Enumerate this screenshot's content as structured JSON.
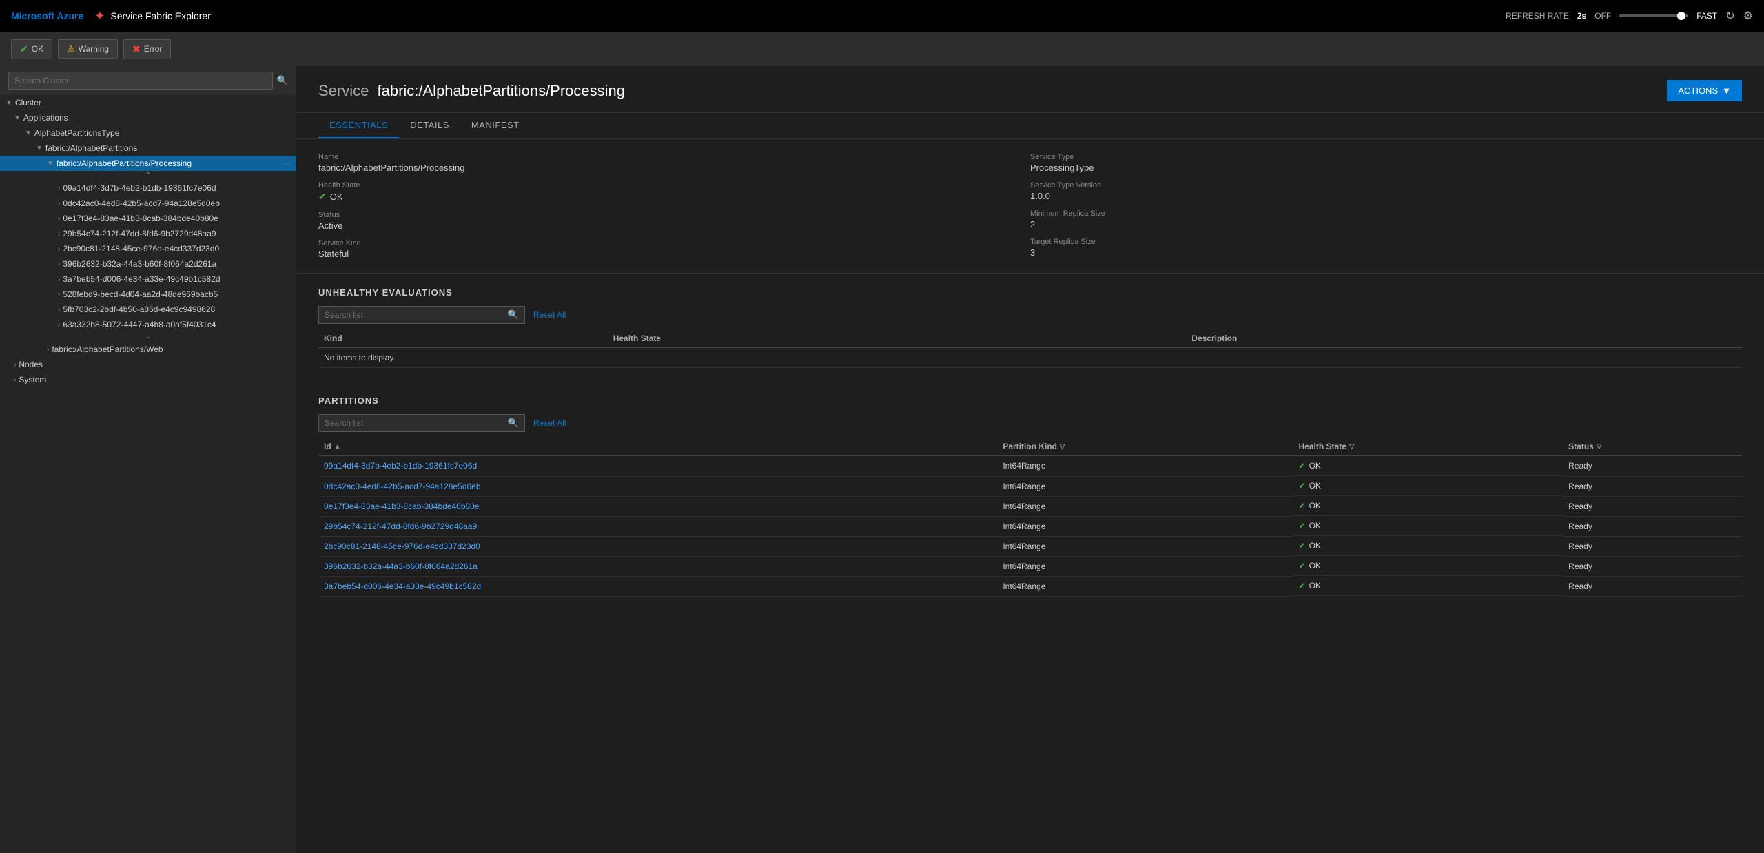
{
  "topnav": {
    "azure_label": "Microsoft Azure",
    "app_title": "Service Fabric Explorer",
    "refresh_rate_label": "REFRESH RATE",
    "refresh_value": "2s",
    "off_label": "OFF",
    "fast_label": "FAST"
  },
  "statusbar": {
    "ok_label": "OK",
    "warning_label": "Warning",
    "error_label": "Error"
  },
  "sidebar": {
    "search_placeholder": "Search Cluster",
    "cluster_label": "Cluster",
    "applications_label": "Applications",
    "alphabet_type_label": "AlphabetPartitionsType",
    "alphabet_app_label": "fabric:/AlphabetPartitions",
    "processing_label": "fabric:/AlphabetPartitions/Processing",
    "partitions": [
      "09a14df4-3d7b-4eb2-b1db-19361fc7e06d",
      "0dc42ac0-4ed8-42b5-acd7-94a128e5d0eb",
      "0e17f3e4-83ae-41b3-8cab-384bde40b80e",
      "29b54c74-212f-47dd-8fd6-9b2729d48aa9",
      "2bc90c81-2148-45ce-976d-e4cd337d23d0",
      "396b2632-b32a-44a3-b60f-8f064a2d261a",
      "3a7beb54-d006-4e34-a33e-49c49b1c582d",
      "528febd9-becd-4d04-aa2d-48de969bacb5",
      "5fb703c2-2bdf-4b50-a86d-e4c9c9498628",
      "63a332b8-5072-4447-a4b8-a0af5f4031c4"
    ],
    "web_label": "fabric:/AlphabetPartitions/Web",
    "nodes_label": "Nodes",
    "system_label": "System"
  },
  "service": {
    "label": "Service",
    "name": "fabric:/AlphabetPartitions/Processing",
    "actions_label": "ACTIONS"
  },
  "tabs": {
    "essentials": "ESSENTIALS",
    "details": "DETAILS",
    "manifest": "MANIFEST"
  },
  "essentials": {
    "name_label": "Name",
    "name_value": "fabric:/AlphabetPartitions/Processing",
    "health_state_label": "Health State",
    "health_state_value": "OK",
    "status_label": "Status",
    "status_value": "Active",
    "service_kind_label": "Service Kind",
    "service_kind_value": "Stateful",
    "service_type_label": "Service Type",
    "service_type_value": "ProcessingType",
    "service_type_version_label": "Service Type Version",
    "service_type_version_value": "1.0.0",
    "min_replica_label": "Minimum Replica Size",
    "min_replica_value": "2",
    "target_replica_label": "Target Replica Size",
    "target_replica_value": "3"
  },
  "unhealthy": {
    "section_title": "UNHEALTHY EVALUATIONS",
    "search_placeholder": "Search list",
    "reset_all": "Reset All",
    "col_kind": "Kind",
    "col_health_state": "Health State",
    "col_description": "Description",
    "no_items": "No items to display."
  },
  "partitions_section": {
    "section_title": "PARTITIONS",
    "search_placeholder": "Search list",
    "reset_all": "Reset All",
    "col_id": "Id",
    "col_partition_kind": "Partition Kind",
    "col_health_state": "Health State",
    "col_status": "Status",
    "rows": [
      {
        "id": "09a14df4-3d7b-4eb2-b1db-19361fc7e06d",
        "kind": "Int64Range",
        "health": "OK",
        "status": "Ready"
      },
      {
        "id": "0dc42ac0-4ed8-42b5-acd7-94a128e5d0eb",
        "kind": "Int64Range",
        "health": "OK",
        "status": "Ready"
      },
      {
        "id": "0e17f3e4-83ae-41b3-8cab-384bde40b80e",
        "kind": "Int64Range",
        "health": "OK",
        "status": "Ready"
      },
      {
        "id": "29b54c74-212f-47dd-8fd6-9b2729d48aa9",
        "kind": "Int64Range",
        "health": "OK",
        "status": "Ready"
      },
      {
        "id": "2bc90c81-2148-45ce-976d-e4cd337d23d0",
        "kind": "Int64Range",
        "health": "OK",
        "status": "Ready"
      },
      {
        "id": "396b2632-b32a-44a3-b60f-8f064a2d261a",
        "kind": "Int64Range",
        "health": "OK",
        "status": "Ready"
      },
      {
        "id": "3a7beb54-d006-4e34-a33e-49c49b1c582d",
        "kind": "Int64Range",
        "health": "OK",
        "status": "Ready"
      }
    ]
  },
  "colors": {
    "ok_green": "#4caf50",
    "warn_yellow": "#ffc107",
    "error_red": "#f44336",
    "accent_blue": "#0078d4",
    "link_blue": "#4da6ff"
  }
}
